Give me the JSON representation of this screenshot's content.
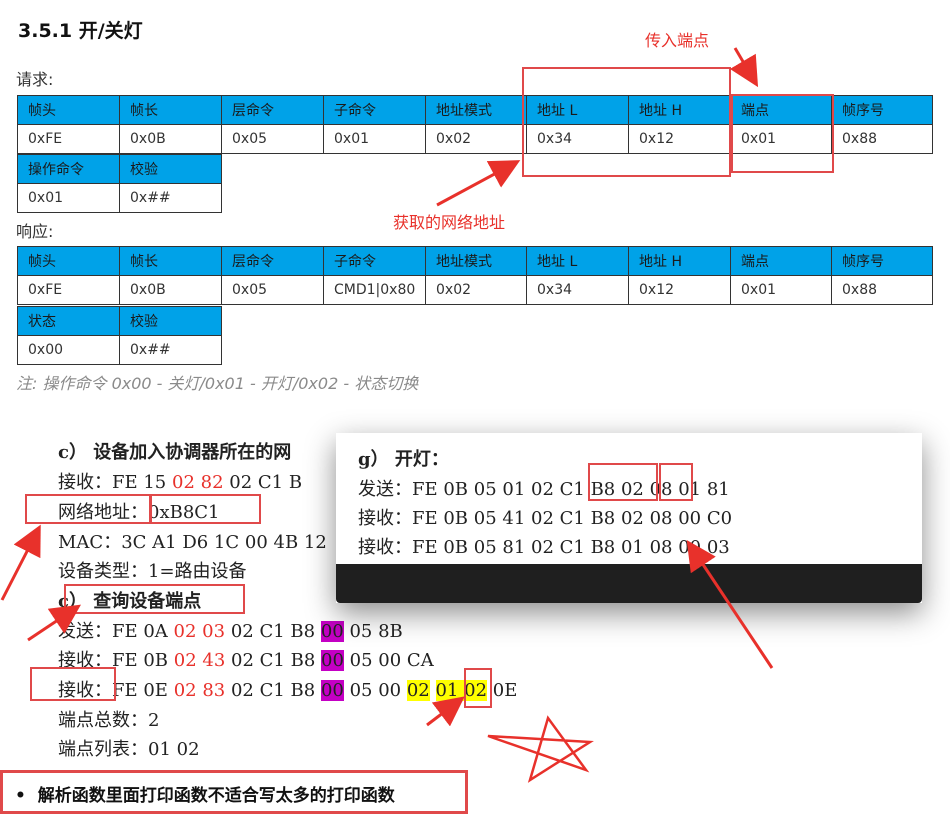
{
  "heading": "3.5.1 开/关灯",
  "request_label": "请求:",
  "response_label": "响应:",
  "request": {
    "headers": [
      "帧头",
      "帧长",
      "层命令",
      "子命令",
      "地址模式",
      "地址 L",
      "地址 H",
      "端点",
      "帧序号"
    ],
    "values": [
      "0xFE",
      "0x0B",
      "0x05",
      "0x01",
      "0x02",
      "0x34",
      "0x12",
      "0x01",
      "0x88"
    ],
    "headers2": [
      "操作命令",
      "校验"
    ],
    "values2": [
      "0x01",
      "0x##"
    ]
  },
  "response": {
    "headers": [
      "帧头",
      "帧长",
      "层命令",
      "子命令",
      "地址模式",
      "地址 L",
      "地址 H",
      "端点",
      "帧序号"
    ],
    "values": [
      "0xFE",
      "0x0B",
      "0x05",
      "CMD1|0x80",
      "0x02",
      "0x34",
      "0x12",
      "0x01",
      "0x88"
    ],
    "headers2": [
      "状态",
      "校验"
    ],
    "values2": [
      "0x00",
      "0x##"
    ]
  },
  "note": "注: 操作命令 0x00 - 关灯/0x01 - 开灯/0x02 - 状态切换",
  "annotations": {
    "endpoint_label": "传入端点",
    "network_addr_label": "获取的网络地址"
  },
  "section_c": {
    "title": "c） 设备加入协调器所在的网",
    "recv_label": "接收：",
    "recv_a": "FE 15",
    "recv_b": "02 82",
    "recv_c": "02 C1 B",
    "netaddr_label": "网络地址",
    "netaddr_sep": "：",
    "netaddr_value": "0xB8C1",
    "mac": "MAC：3C A1 D6 1C 00 4B 12",
    "devtype": "设备类型：1=路由设备"
  },
  "section_d": {
    "title_prefix": "c）",
    "title": "查询设备端点",
    "send_label": "发送：",
    "send_a": "FE 0A",
    "send_b": "02 03",
    "send_c": "02 C1 B8",
    "send_d": "00",
    "send_e": "05 8B",
    "recv1_label": "接收：",
    "recv1_a": "FE 0B",
    "recv1_b": "02 43",
    "recv1_c": "02 C1 B8",
    "recv1_d": "00",
    "recv1_e": "05 00 CA",
    "recv2_label": "接收：",
    "recv2_a": "FE 0E",
    "recv2_b": "02 83",
    "recv2_c": "02 C1 B8",
    "recv2_d": "00",
    "recv2_e": "05 00",
    "recv2_f": "02",
    "recv2_g": "01 02",
    "recv2_h": "0E",
    "count": "端点总数：2",
    "list": "端点列表：01 02"
  },
  "popup": {
    "title": "g） 开灯：",
    "send": "发送：FE 0B 05 01 02 C1 B8 02 08 01 81",
    "recv1": "接收：FE 0B 05 41 02 C1 B8 02 08 00 C0",
    "recv2": "接收：FE 0B 05 81 02 C1 B8 01 08 00 03"
  },
  "bullet": "解析函数里面打印函数不适合写太多的打印函数",
  "colors": {
    "header_blue": "#00a2e8",
    "annotation_red": "#e8312b",
    "highlight_magenta": "#c400c4",
    "highlight_yellow": "#ffff00"
  }
}
